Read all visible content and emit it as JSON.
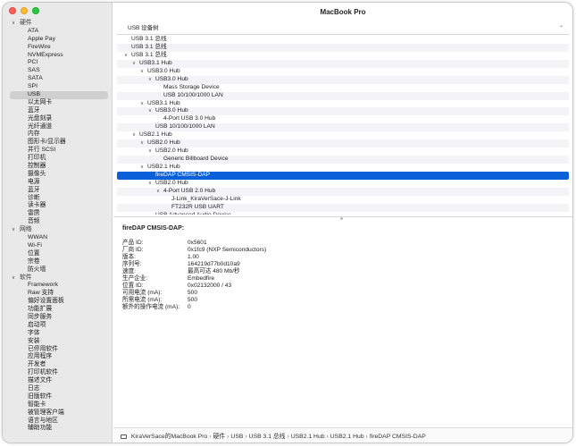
{
  "window": {
    "title": "MacBook Pro"
  },
  "sidebar": {
    "groups": [
      {
        "label": "硬件",
        "items": [
          "ATA",
          "Apple Pay",
          "FireWire",
          "NVMExpress",
          "PCI",
          "SAS",
          "SATA",
          "SPI",
          "USB",
          "以太网卡",
          "蓝牙",
          "光盘刻录",
          "光纤通道",
          "内存",
          "图形卡/显示器",
          "并行 SCSI",
          "打印机",
          "控制器",
          "摄像头",
          "电源",
          "蓝牙",
          "诊断",
          "读卡器",
          "雷雳",
          "音频"
        ]
      },
      {
        "label": "网络",
        "items": [
          "WWAN",
          "Wi-Fi",
          "位置",
          "宗卷",
          "防火墙"
        ]
      },
      {
        "label": "软件",
        "items": [
          "Framework",
          "Raw 支持",
          "偏好设置面板",
          "功能扩展",
          "同步服务",
          "启动项",
          "字体",
          "安装",
          "已停用软件",
          "应用程序",
          "开发者",
          "打印机软件",
          "描述文件",
          "日志",
          "旧版软件",
          "智能卡",
          "被管理客户端",
          "语言与地区",
          "辅助功能"
        ]
      }
    ],
    "selected": "USB"
  },
  "tree": {
    "header": "USB 设备树",
    "rows": [
      {
        "label": "USB 3.1 总线",
        "level": 0,
        "chev": ""
      },
      {
        "label": "USB 3.1 总线",
        "level": 0,
        "chev": ""
      },
      {
        "label": "USB 3.1 总线",
        "level": 0,
        "chev": "∨"
      },
      {
        "label": "USB3.1 Hub",
        "level": 1,
        "chev": "∨"
      },
      {
        "label": "USB3.0 Hub",
        "level": 2,
        "chev": "∨"
      },
      {
        "label": "USB3.0 Hub",
        "level": 3,
        "chev": "∨"
      },
      {
        "label": "Mass Storage Device",
        "level": 4,
        "chev": ""
      },
      {
        "label": "USB 10/100/1000 LAN",
        "level": 4,
        "chev": ""
      },
      {
        "label": "USB3.1 Hub",
        "level": 2,
        "chev": "∨"
      },
      {
        "label": "USB3.0 Hub",
        "level": 3,
        "chev": "∨"
      },
      {
        "label": "4-Port USB 3.0 Hub",
        "level": 4,
        "chev": ""
      },
      {
        "label": "USB 10/100/1000 LAN",
        "level": 3,
        "chev": ""
      },
      {
        "label": "USB2.1 Hub",
        "level": 1,
        "chev": "∨"
      },
      {
        "label": "USB2.0 Hub",
        "level": 2,
        "chev": "∨"
      },
      {
        "label": "USB2.0 Hub",
        "level": 3,
        "chev": "∨"
      },
      {
        "label": "Generic Billboard Device",
        "level": 4,
        "chev": ""
      },
      {
        "label": "USB2.1 Hub",
        "level": 2,
        "chev": "∨"
      },
      {
        "label": "fireDAP CMSIS-DAP",
        "level": 3,
        "chev": "",
        "selected": true
      },
      {
        "label": "USB2.0 Hub",
        "level": 3,
        "chev": "∨"
      },
      {
        "label": "4-Port USB 2.0 Hub",
        "level": 4,
        "chev": "∨"
      },
      {
        "label": "J-Link_KiraVerSace-J-Link",
        "level": 5,
        "chev": ""
      },
      {
        "label": "FT232R USB UART",
        "level": 5,
        "chev": ""
      },
      {
        "label": "USB Advanced Audio Device",
        "level": 3,
        "chev": ""
      }
    ]
  },
  "detail": {
    "title": "fireDAP CMSIS-DAP:",
    "props": [
      {
        "k": "产品 ID:",
        "v": "0x5601"
      },
      {
        "k": "厂商 ID:",
        "v": "0x1fc9  (NXP Semiconductors)"
      },
      {
        "k": "版本:",
        "v": "1.00"
      },
      {
        "k": "序列号:",
        "v": "164219d77b0d10a9"
      },
      {
        "k": "速度:",
        "v": "最高可达 480 Mb/秒"
      },
      {
        "k": "生产企业:",
        "v": "Embedfire"
      },
      {
        "k": "位置 ID:",
        "v": "0x02132000 / 43"
      },
      {
        "k": "可用电流 (mA):",
        "v": "500"
      },
      {
        "k": "所需电流 (mA):",
        "v": "500"
      },
      {
        "k": "额外的操作电流 (mA):",
        "v": "0"
      }
    ]
  },
  "pathbar": {
    "items": [
      "KiraVerSace的MacBook Pro",
      "硬件",
      "USB",
      "USB 3.1 总线",
      "USB2.1 Hub",
      "USB2.1 Hub",
      "fireDAP CMSIS-DAP"
    ],
    "separator": "›"
  }
}
